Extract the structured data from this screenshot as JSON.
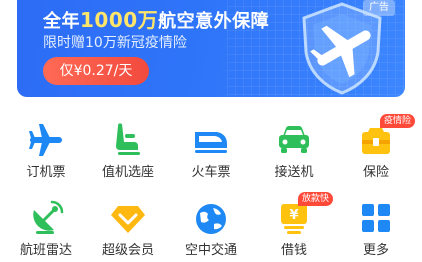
{
  "banner": {
    "title_pre": "全年",
    "title_highlight": "1000万",
    "title_post": "航空意外保障",
    "subtitle": "限时赠10万新冠疫情险",
    "price_button": "仅¥0.27/天",
    "ad_tag": "广告",
    "colors": {
      "bg": "#2e74f9",
      "highlight": "#ffe56a",
      "button": "#f24a3e"
    }
  },
  "grid": {
    "row1": [
      {
        "label": "订机票",
        "icon": "airplane-icon"
      },
      {
        "label": "值机选座",
        "icon": "seat-icon"
      },
      {
        "label": "火车票",
        "icon": "train-icon"
      },
      {
        "label": "接送机",
        "icon": "car-icon"
      },
      {
        "label": "保险",
        "icon": "insurance-icon",
        "badge": "疫情险"
      }
    ],
    "row2": [
      {
        "label": "航班雷达",
        "icon": "radar-icon"
      },
      {
        "label": "超级会员",
        "icon": "diamond-icon"
      },
      {
        "label": "空中交通",
        "icon": "globe-icon"
      },
      {
        "label": "借钱",
        "icon": "money-icon",
        "badge": "放款快"
      },
      {
        "label": "更多",
        "icon": "more-grid-icon"
      }
    ]
  }
}
